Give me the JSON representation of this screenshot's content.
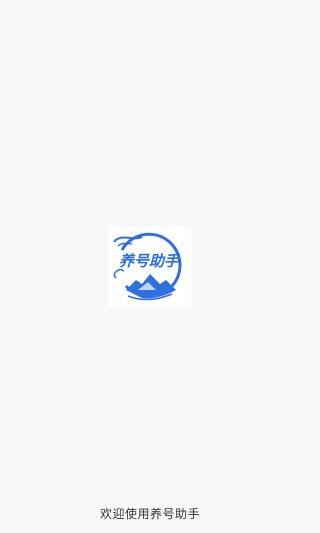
{
  "splash": {
    "logo": {
      "icon": "app-logo-icon",
      "wordmark": "养号助手",
      "primary_color": "#2f6fe0",
      "background_color": "#ffffff"
    },
    "welcome_text": "欢迎使用养号助手"
  },
  "theme": {
    "page_background": "#f8f8f8",
    "text_color": "#333333"
  }
}
